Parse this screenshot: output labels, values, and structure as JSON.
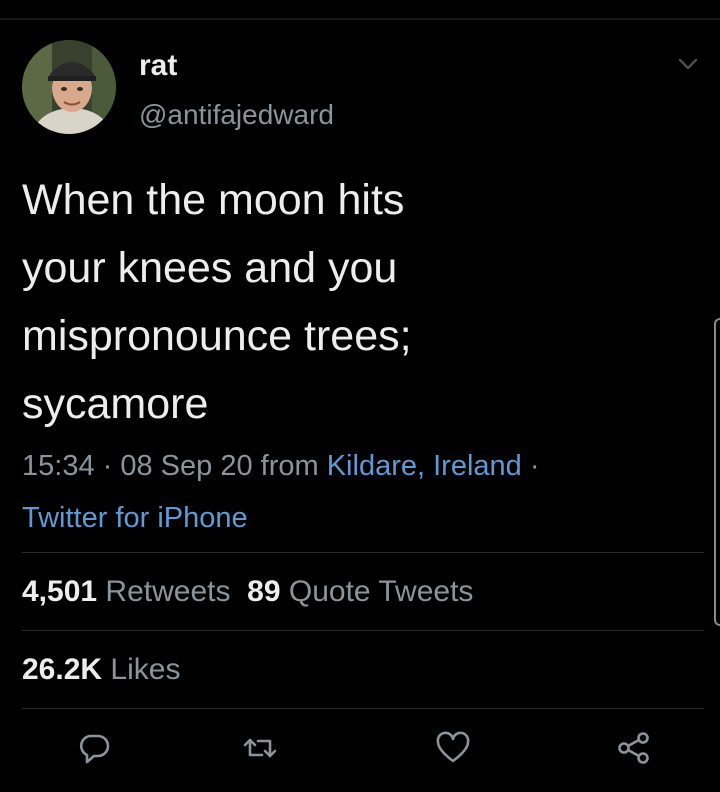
{
  "author": {
    "display_name": "rat",
    "handle": "@antifajedward",
    "avatar_icon": "profile-photo"
  },
  "tweet": {
    "text": "When the moon hits\nyour knees and you\nmispronounce trees;\nsycamore"
  },
  "meta": {
    "time": "15:34",
    "sep1": " · ",
    "date": "08 Sep 20",
    "from_word": " from ",
    "location": "Kildare, Ireland",
    "sep2": " · ",
    "source": "Twitter for iPhone"
  },
  "stats": {
    "retweets_count": "4,501",
    "retweets_label": "Retweets",
    "quotes_count": "89",
    "quotes_label": "Quote Tweets",
    "likes_count": "26.2K",
    "likes_label": "Likes"
  },
  "actions": [
    {
      "name": "reply",
      "icon": "speech-bubble-icon"
    },
    {
      "name": "retweet",
      "icon": "retweet-icon"
    },
    {
      "name": "like",
      "icon": "heart-icon"
    },
    {
      "name": "share",
      "icon": "share-icon"
    }
  ],
  "colors": {
    "background": "#000000",
    "text": "#ededed",
    "secondary": "#8b949b",
    "link": "#5e9ad6"
  }
}
